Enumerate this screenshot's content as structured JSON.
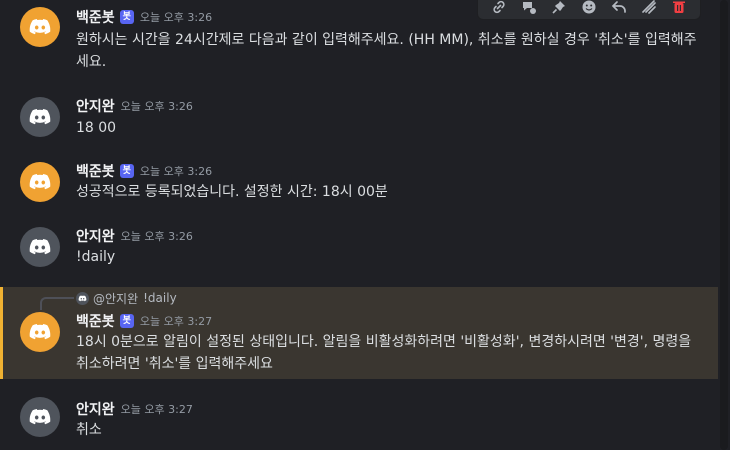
{
  "toolbar": {
    "icons": [
      "link-icon",
      "thread-icon",
      "pin-icon",
      "emoji-icon",
      "reply-icon",
      "forward-icon",
      "delete-icon"
    ],
    "danger_color": "#f23f43"
  },
  "colors": {
    "bot_avatar": "#f0a232",
    "user_avatar": "#4f545c",
    "bot_tag": "#5865f2",
    "highlight_bg": "#3a3630",
    "highlight_border": "#f0b232"
  },
  "messages": [
    {
      "author": "백준봇",
      "bot_tag": "봇",
      "time": "오늘 오후 3:26",
      "text": "원하시는 시간을 24시간제로 다음과 같이 입력해주세요. (HH MM), 취소를 원하실 경우 '취소'를 입력해주세요."
    },
    {
      "author": "안지완",
      "time": "오늘 오후 3:26",
      "text": "18 00"
    },
    {
      "author": "백준봇",
      "bot_tag": "봇",
      "time": "오늘 오후 3:26",
      "text": "성공적으로 등록되었습니다. 설정한 시간: 18시 00분"
    },
    {
      "author": "안지완",
      "time": "오늘 오후 3:26",
      "text": "!daily"
    },
    {
      "reply_to": {
        "author": "@안지완",
        "text": "!daily"
      },
      "author": "백준봇",
      "bot_tag": "봇",
      "time": "오늘 오후 3:27",
      "text": "18시 0분으로 알림이 설정된 상태입니다. 알림을 비활성화하려면 '비활성화', 변경하시려면 '변경', 명령을 취소하려면 '취소'를 입력해주세요"
    },
    {
      "author": "안지완",
      "time": "오늘 오후 3:27",
      "text": "취소"
    }
  ]
}
